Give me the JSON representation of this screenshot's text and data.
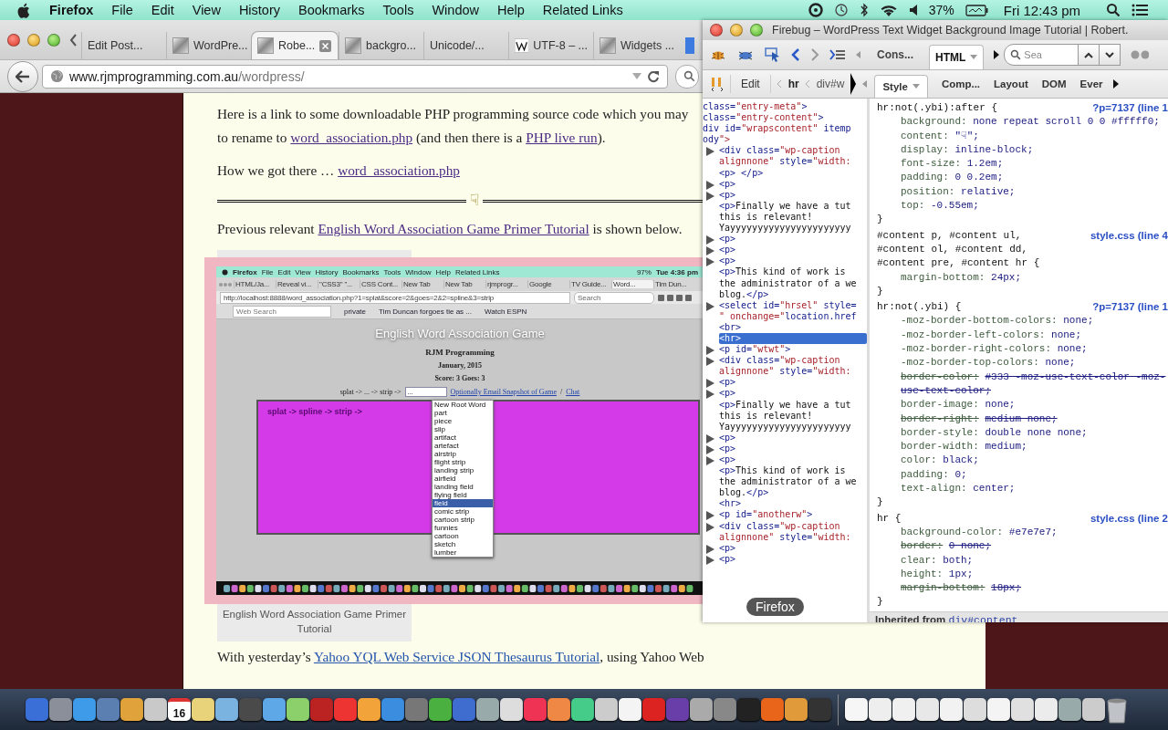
{
  "menubar": {
    "app": "Firefox",
    "items": [
      "File",
      "Edit",
      "View",
      "History",
      "Bookmarks",
      "Tools",
      "Window",
      "Help",
      "Related Links"
    ],
    "battery": "37%",
    "clock": "Fri 12:43 pm"
  },
  "browser": {
    "tabs": [
      {
        "label": "Edit Post...",
        "selected": false,
        "kind": "plain"
      },
      {
        "label": "WordPre...",
        "selected": false,
        "kind": "page"
      },
      {
        "label": "Robe...",
        "selected": true,
        "kind": "page"
      },
      {
        "label": "backgro...",
        "selected": false,
        "kind": "page"
      },
      {
        "label": "Unicode/...",
        "selected": false,
        "kind": "plain"
      },
      {
        "label": "UTF-8 – ...",
        "selected": false,
        "kind": "wiki"
      },
      {
        "label": "Widgets ...",
        "selected": false,
        "kind": "page"
      }
    ],
    "url_host": "www.rjmprogramming.com.au",
    "url_path": "/wordpress/"
  },
  "page": {
    "paragraph_1": [
      [
        {
          "text": "Here is a link to some downloadable PHP programming source code which you may"
        }
      ],
      [
        {
          "text": "to rename to "
        },
        {
          "link": "word_association.php"
        },
        {
          "text": " (and then there is a "
        },
        {
          "link": "PHP live run"
        },
        {
          "text": ")."
        }
      ]
    ],
    "paragraph_2": [
      [
        {
          "text": "How we got there … "
        },
        {
          "link": "word_association.php"
        }
      ]
    ],
    "divider_glyph": "☟",
    "paragraph_3": [
      [
        {
          "text": "Previous relevant "
        },
        {
          "link": "English Word Association Game Primer Tutorial"
        },
        {
          "text": " is shown below."
        }
      ]
    ],
    "caption": "English Word Association Game Primer Tutorial",
    "paragraph_4": [
      [
        {
          "text": "With yesterday’s "
        },
        {
          "link": "Yahoo YQL Web Service JSON Thesaurus Tutorial"
        },
        {
          "text": ", using Yahoo Web"
        }
      ]
    ]
  },
  "embedded_screenshot": {
    "menu": [
      "Firefox",
      "File",
      "Edit",
      "View",
      "History",
      "Bookmarks",
      "Tools",
      "Window",
      "Help",
      "Related Links"
    ],
    "battery": "97%",
    "clock": "Tue 4:36 pm",
    "tabs": [
      {
        "label": "HTML/Ja...",
        "selected": false
      },
      {
        "label": "Reveal vi...",
        "selected": false
      },
      {
        "label": "\"CSS3\" \"...",
        "selected": false
      },
      {
        "label": "CSS Cont...",
        "selected": false
      },
      {
        "label": "New Tab",
        "selected": false
      },
      {
        "label": "New Tab",
        "selected": false
      },
      {
        "label": "rjmprogr...",
        "selected": false
      },
      {
        "label": "Google",
        "selected": false
      },
      {
        "label": "TV Guide...",
        "selected": false
      },
      {
        "label": "Word...",
        "selected": true
      },
      {
        "label": "Tim Dun...",
        "selected": false
      }
    ],
    "url": "http://localhost:8888/word_association.php?1=splat&score=2&goes=2&2=spline&3=strip",
    "search_placeholder": "Search",
    "toolbar_search_placeholder": "Web Search",
    "toolbar_items": [
      "private",
      "Tim Duncan forgoes tie as ...",
      "Watch ESPN"
    ],
    "game": {
      "title": "English Word Association Game",
      "author": "RJM Programming",
      "date": "January, 2015",
      "score": "Score: 3 Goes: 3",
      "prompt": "splat -> ... -> strip ->",
      "select_value": "...",
      "email_link": "Optionally Email Snapshot of Game",
      "separator": "/",
      "chat_link": "Chat",
      "canvas_text": "splat -> spline -> strip ->",
      "options": [
        {
          "label": "New Root Word",
          "selected": false
        },
        {
          "label": "part",
          "selected": false
        },
        {
          "label": "piece",
          "selected": false
        },
        {
          "label": "slip",
          "selected": false
        },
        {
          "label": "artifact",
          "selected": false
        },
        {
          "label": "artefact",
          "selected": false
        },
        {
          "label": "airstrip",
          "selected": false
        },
        {
          "label": "flight strip",
          "selected": false
        },
        {
          "label": "landing strip",
          "selected": false
        },
        {
          "label": "airfield",
          "selected": false
        },
        {
          "label": "landing field",
          "selected": false
        },
        {
          "label": "flying field",
          "selected": false
        },
        {
          "label": "field",
          "selected": true
        },
        {
          "label": "comic strip",
          "selected": false
        },
        {
          "label": "cartoon strip",
          "selected": false
        },
        {
          "label": "funnies",
          "selected": false
        },
        {
          "label": "cartoon",
          "selected": false
        },
        {
          "label": "sketch",
          "selected": false
        },
        {
          "label": "lumber",
          "selected": false
        }
      ]
    }
  },
  "firebug": {
    "title": "Firebug – WordPress Text Widget Background Image Tutorial | Robert.",
    "main_tabs": [
      {
        "label": "Cons...",
        "selected": false,
        "dropdown": false
      },
      {
        "label": "HTML",
        "selected": true,
        "dropdown": true
      }
    ],
    "search_placeholder": "Sea",
    "edit_button": "Edit",
    "breadcrumbs": [
      "hr",
      "div#w"
    ],
    "side_tabs": [
      {
        "label": "Style",
        "selected": true,
        "dropdown": true
      },
      {
        "label": "Comp...",
        "selected": false,
        "dropdown": false
      },
      {
        "label": "Layout",
        "selected": false,
        "dropdown": false
      },
      {
        "label": "DOM",
        "selected": false,
        "dropdown": false
      },
      {
        "label": "Ever",
        "selected": false,
        "dropdown": false
      }
    ],
    "html_panel": {
      "nodes": [
        {
          "lines": [
            "class=\"entry-meta\">"
          ],
          "expandable": false,
          "selected": false
        },
        {
          "lines": [
            "class=\"entry-content\">"
          ],
          "expandable": false,
          "selected": false
        },
        {
          "lines": [
            "div id=\"wrapscontent\" itemp"
          ],
          "expandable": false,
          "selected": false
        },
        {
          "lines": [
            "ody\">"
          ],
          "expandable": false,
          "selected": false,
          "children": [
            {
              "lines": [
                "<div class=\"wp-caption",
                "alignnone\" style=\"width:"
              ],
              "expandable": true,
              "selected": false
            },
            {
              "lines": [
                "<p> </p>"
              ],
              "expandable": false,
              "selected": false
            },
            {
              "lines": [
                "<p>"
              ],
              "expandable": true,
              "selected": false
            },
            {
              "lines": [
                "<p>"
              ],
              "expandable": true,
              "selected": false
            },
            {
              "lines": [
                "<p>Finally we have a tut",
                "this is relevant!",
                "Yayyyyyyyyyyyyyyyyyyyyyy"
              ],
              "expandable": false,
              "selected": false
            },
            {
              "lines": [
                "<p>"
              ],
              "expandable": true,
              "selected": false
            },
            {
              "lines": [
                "<p>"
              ],
              "expandable": true,
              "selected": false
            },
            {
              "lines": [
                "<p>"
              ],
              "expandable": true,
              "selected": false
            },
            {
              "lines": [
                "<p>This kind of work is",
                "the administrator of a we",
                "blog.</p>"
              ],
              "expandable": false,
              "selected": false
            },
            {
              "lines": [
                "<select id=\"hrsel\" style=",
                "\" onchange=\"location.href"
              ],
              "expandable": true,
              "selected": false
            },
            {
              "lines": [
                "<br>"
              ],
              "expandable": false,
              "selected": false
            },
            {
              "lines": [
                "<hr>"
              ],
              "expandable": false,
              "selected": true
            },
            {
              "lines": [
                "<p id=\"wtwt\">"
              ],
              "expandable": true,
              "selected": false
            },
            {
              "lines": [
                "<div class=\"wp-caption",
                "alignnone\" style=\"width:"
              ],
              "expandable": true,
              "selected": false
            },
            {
              "lines": [
                "<p>"
              ],
              "expandable": true,
              "selected": false
            },
            {
              "lines": [
                "<p>"
              ],
              "expandable": true,
              "selected": false
            },
            {
              "lines": [
                "<p>Finally we have a tut",
                "this is relevant!",
                "Yayyyyyyyyyyyyyyyyyyyyyy"
              ],
              "expandable": false,
              "selected": false
            },
            {
              "lines": [
                "<p>"
              ],
              "expandable": true,
              "selected": false
            },
            {
              "lines": [
                "<p>"
              ],
              "expandable": true,
              "selected": false
            },
            {
              "lines": [
                "<p>"
              ],
              "expandable": true,
              "selected": false
            },
            {
              "lines": [
                "<p>This kind of work is",
                "the administrator of a we",
                "blog.</p>"
              ],
              "expandable": false,
              "selected": false
            },
            {
              "lines": [
                "<hr>"
              ],
              "expandable": false,
              "selected": false
            },
            {
              "lines": [
                "<p id=\"anotherw\">"
              ],
              "expandable": true,
              "selected": false
            },
            {
              "lines": [
                "<div class=\"wp-caption",
                "alignnone\" style=\"width:"
              ],
              "expandable": true,
              "selected": false
            },
            {
              "lines": [
                "<p>"
              ],
              "expandable": true,
              "selected": false
            },
            {
              "lines": [
                "<p>"
              ],
              "expandable": true,
              "selected": false
            }
          ]
        }
      ]
    },
    "style_panel": {
      "rules": [
        {
          "selector": [
            "hr:not(.ybi):after {"
          ],
          "source": "?p=7137 (line 1",
          "close": "}",
          "properties": [
            {
              "name": "background:",
              "value": "none repeat scroll 0 0 #fffff0;",
              "overridden": false
            },
            {
              "name": "content:",
              "value": "\"☟\";",
              "overridden": false
            },
            {
              "name": "display:",
              "value": "inline-block;",
              "overridden": false
            },
            {
              "name": "font-size:",
              "value": "1.2em;",
              "overridden": false
            },
            {
              "name": "padding:",
              "value": "0 0.2em;",
              "overridden": false
            },
            {
              "name": "position:",
              "value": "relative;",
              "overridden": false
            },
            {
              "name": "top:",
              "value": "-0.55em;",
              "overridden": false
            }
          ]
        },
        {
          "selector": [
            "#content p, #content ul,",
            "#content ol, #content dd,",
            "#content pre, #content hr {"
          ],
          "source": "style.css (line 4",
          "close": "}",
          "properties": [
            {
              "name": "margin-bottom:",
              "value": "24px;",
              "overridden": false
            }
          ]
        },
        {
          "selector": [
            "hr:not(.ybi) {"
          ],
          "source": "?p=7137 (line 1",
          "close": "}",
          "properties": [
            {
              "name": "-moz-border-bottom-colors:",
              "value": "none;",
              "overridden": false
            },
            {
              "name": "-moz-border-left-colors:",
              "value": "none;",
              "overridden": false
            },
            {
              "name": "-moz-border-right-colors:",
              "value": "none;",
              "overridden": false
            },
            {
              "name": "-moz-border-top-colors:",
              "value": "none;",
              "overridden": false
            },
            {
              "name": "border-color:",
              "value": "#333 -moz-use-text-color -moz-use-text-color;",
              "overridden": true
            },
            {
              "name": "border-image:",
              "value": "none;",
              "overridden": false
            },
            {
              "name": "border-right:",
              "value": "medium none;",
              "overridden": true
            },
            {
              "name": "border-style:",
              "value": "double none none;",
              "overridden": false
            },
            {
              "name": "border-width:",
              "value": "medium;",
              "overridden": false
            },
            {
              "name": "color:",
              "value": "black;",
              "overridden": false
            },
            {
              "name": "padding:",
              "value": "0;",
              "overridden": false
            },
            {
              "name": "text-align:",
              "value": "center;",
              "overridden": false
            }
          ]
        },
        {
          "selector": [
            "hr {"
          ],
          "source": "style.css (line 2",
          "close": "}",
          "properties": [
            {
              "name": "background-color:",
              "value": "#e7e7e7;",
              "overridden": false
            },
            {
              "name": "border:",
              "value": "0 none;",
              "overridden": true
            },
            {
              "name": "clear:",
              "value": "both;",
              "overridden": false
            },
            {
              "name": "height:",
              "value": "1px;",
              "overridden": false
            },
            {
              "name": "margin-bottom:",
              "value": "18px;",
              "overridden": true
            }
          ]
        }
      ],
      "inherited_label": "Inherited from",
      "inherited_source": "div#content"
    }
  },
  "tooltip": "Firefox",
  "dock": {
    "calendar_day": "16"
  }
}
